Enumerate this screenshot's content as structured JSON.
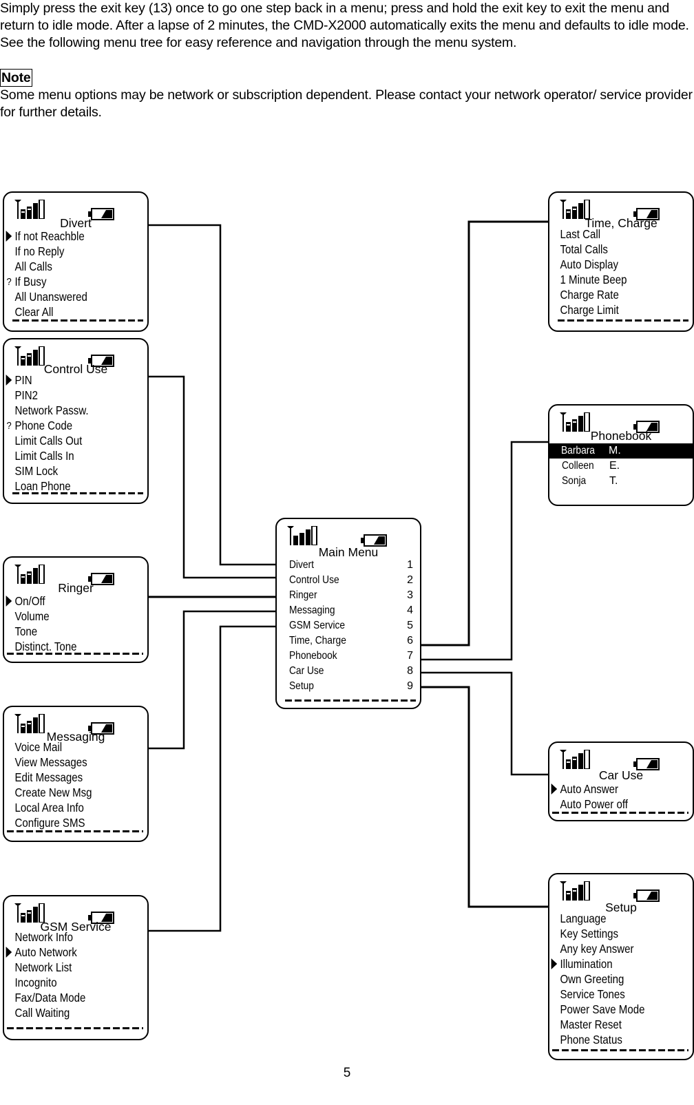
{
  "intro": {
    "paragraph1": "Simply press the exit key (13) once to go one step back in a menu; press and hold the exit key to exit the menu and return to idle mode. After a lapse of 2 minutes, the CMD-X2000 automatically exits the menu and defaults to idle mode.",
    "paragraph2": "See the following menu tree for easy reference and navigation through the menu system.",
    "note_label": "Note",
    "note_text": "Some menu options may be network or subscription dependent. Please contact your network operator/ service provider for further details."
  },
  "icons": {
    "signal": "signal-strength-icon",
    "battery": "battery-icon",
    "cursor": "selection-arrow-icon",
    "question": "?"
  },
  "main_menu": {
    "title": "Main Menu",
    "items": [
      {
        "label": "Divert",
        "num": "1"
      },
      {
        "label": "Control Use",
        "num": "2"
      },
      {
        "label": "Ringer",
        "num": "3"
      },
      {
        "label": "Messaging",
        "num": "4"
      },
      {
        "label": "GSM Service",
        "num": "5"
      },
      {
        "label": "Time, Charge",
        "num": "6"
      },
      {
        "label": "Phonebook",
        "num": "7"
      },
      {
        "label": "Car Use",
        "num": "8"
      },
      {
        "label": "Setup",
        "num": "9"
      }
    ]
  },
  "divert": {
    "title": "Divert",
    "items": [
      {
        "label": "If not Reachble",
        "mark": "arrow"
      },
      {
        "label": "If no Reply",
        "mark": ""
      },
      {
        "label": "All Calls",
        "mark": ""
      },
      {
        "label": "If Busy",
        "mark": "?"
      },
      {
        "label": "All Unanswered",
        "mark": ""
      },
      {
        "label": "Clear All",
        "mark": ""
      }
    ]
  },
  "control_use": {
    "title": "Control Use",
    "items": [
      {
        "label": "PIN",
        "mark": "arrow"
      },
      {
        "label": "PIN2",
        "mark": ""
      },
      {
        "label": "Network Passw.",
        "mark": ""
      },
      {
        "label": "Phone Code",
        "mark": "?"
      },
      {
        "label": "Limit Calls Out",
        "mark": ""
      },
      {
        "label": "Limit Calls In",
        "mark": ""
      },
      {
        "label": "SIM Lock",
        "mark": ""
      },
      {
        "label": "Loan Phone",
        "mark": ""
      }
    ]
  },
  "ringer": {
    "title": "Ringer",
    "items": [
      {
        "label": "On/Off",
        "mark": "arrow"
      },
      {
        "label": "Volume",
        "mark": ""
      },
      {
        "label": "Tone",
        "mark": ""
      },
      {
        "label": "Distinct. Tone",
        "mark": ""
      }
    ]
  },
  "messaging": {
    "title": "Messaging",
    "items": [
      {
        "label": "Voice Mail",
        "mark": ""
      },
      {
        "label": "View Messages",
        "mark": ""
      },
      {
        "label": "Edit Messages",
        "mark": ""
      },
      {
        "label": "Create New Msg",
        "mark": ""
      },
      {
        "label": "Local Area Info",
        "mark": ""
      },
      {
        "label": "Configure SMS",
        "mark": ""
      }
    ]
  },
  "gsm_service": {
    "title": "GSM Service",
    "items": [
      {
        "label": "Network Info",
        "mark": ""
      },
      {
        "label": "Auto Network",
        "mark": "arrow"
      },
      {
        "label": "Network List",
        "mark": ""
      },
      {
        "label": "Incognito",
        "mark": ""
      },
      {
        "label": "Fax/Data Mode",
        "mark": ""
      },
      {
        "label": "Call Waiting",
        "mark": ""
      }
    ]
  },
  "time_charge": {
    "title": "Time, Charge",
    "items": [
      {
        "label": "Last Call",
        "mark": ""
      },
      {
        "label": "Total Calls",
        "mark": ""
      },
      {
        "label": "Auto Display",
        "mark": ""
      },
      {
        "label": "1 Minute Beep",
        "mark": ""
      },
      {
        "label": "Charge Rate",
        "mark": ""
      },
      {
        "label": "Charge Limit",
        "mark": ""
      }
    ]
  },
  "phonebook": {
    "title": "Phonebook",
    "entries": [
      {
        "name": "Barbara",
        "initial": "M.",
        "selected": true
      },
      {
        "name": "Colleen",
        "initial": "E.",
        "selected": false
      },
      {
        "name": "Sonja",
        "initial": "T.",
        "selected": false
      }
    ]
  },
  "car_use": {
    "title": "Car Use",
    "items": [
      {
        "label": "Auto Answer",
        "mark": "arrow"
      },
      {
        "label": "Auto Power off",
        "mark": ""
      }
    ]
  },
  "setup": {
    "title": "Setup",
    "items": [
      {
        "label": "Language",
        "mark": ""
      },
      {
        "label": "Key Settings",
        "mark": ""
      },
      {
        "label": "Any key Answer",
        "mark": ""
      },
      {
        "label": "Illumination",
        "mark": "arrow"
      },
      {
        "label": "Own Greeting",
        "mark": ""
      },
      {
        "label": "Service Tones",
        "mark": ""
      },
      {
        "label": "Power Save Mode",
        "mark": ""
      },
      {
        "label": "Master Reset",
        "mark": ""
      },
      {
        "label": "Phone Status",
        "mark": ""
      }
    ]
  },
  "page_number": "5"
}
